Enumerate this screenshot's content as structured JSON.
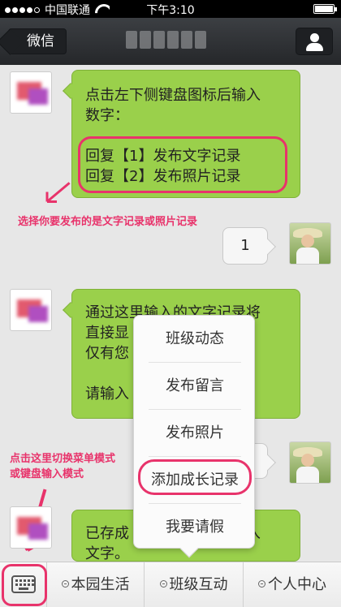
{
  "status_bar": {
    "carrier": "中国联通",
    "time": "下午3:10"
  },
  "nav": {
    "back_label": "微信"
  },
  "messages": {
    "m1": {
      "lines": "点击左下侧键盘图标后输入\n数字：\n\n回复【1】发布文字记录\n回复【2】发布照片记录"
    },
    "m2": {
      "text": "1"
    },
    "m3": {
      "lines": "通过这里输入的文字记录将\n直接显                      上，\n仅有您                      。\n\n请输入"
    },
    "m5": {
      "lines": "已存成                      输入\n文字。"
    }
  },
  "annotations": {
    "a1": "选择你要发布的是文字记录或照片记录",
    "a2_line1": "点击这里切换菜单模式",
    "a2_line2": "或键盘输入模式"
  },
  "popup_menu": {
    "items": [
      "班级动态",
      "发布留言",
      "发布照片",
      "添加成长记录",
      "我要请假"
    ]
  },
  "bottom_bar": {
    "tabs": [
      "本园生活",
      "班级互动",
      "个人中心"
    ]
  },
  "colors": {
    "accent": "#e8336b",
    "bubble_green": "#9ad04b"
  }
}
